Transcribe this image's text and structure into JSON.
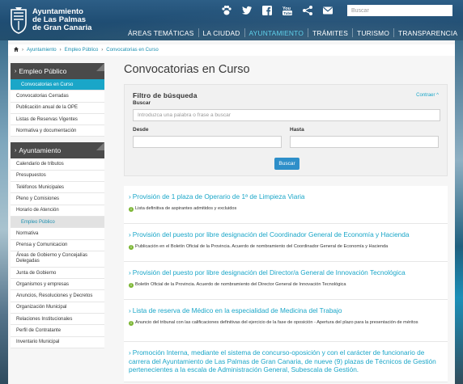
{
  "header": {
    "logo_line1": "Ayuntamiento",
    "logo_line2": "de Las Palmas",
    "logo_line3": "de Gran Canaria",
    "search_placeholder": "Buscar",
    "social_icons": [
      "paw-icon",
      "twitter-icon",
      "facebook-icon",
      "youtube-icon",
      "share-icon",
      "mail-icon"
    ],
    "nav": [
      {
        "label": "ÁREAS TEMÁTICAS",
        "active": false
      },
      {
        "label": "LA CIUDAD",
        "active": false
      },
      {
        "label": "AYUNTAMIENTO",
        "active": true
      },
      {
        "label": "TRÁMITES",
        "active": false
      },
      {
        "label": "TURISMO",
        "active": false
      },
      {
        "label": "TRANSPARENCIA",
        "active": false
      }
    ]
  },
  "breadcrumb": [
    "Ayuntamiento",
    "Empleo Público",
    "Convocatorias en Curso"
  ],
  "sidebar": {
    "section1_title": "Empleo Público",
    "section1_items": [
      "Convocatorias en Curso",
      "Convocatorias Cerradas",
      "Publicación anual de la OPE",
      "Listas de Reservas Vigentes",
      "Normativa y documentación"
    ],
    "section2_title": "Ayuntamiento",
    "section2_items": [
      "Calendario de tributos",
      "Presupuestos",
      "Teléfonos Municipales",
      "Pleno y Comisiones",
      "Horario de Atención",
      "Empleo Público",
      "Normativa",
      "Prensa y Comunicacion",
      "Áreas de Gobierno y Concejalías Delegadas",
      "Junta de Gobierno",
      "Organismos y empresas",
      "Anuncios, Resoluciones y Decretos",
      "Organización Municipal",
      "Relaciones Institucionales",
      "Perfil de Contratante",
      "Inventario Municipal"
    ]
  },
  "main": {
    "title": "Convocatorias en Curso",
    "filter": {
      "title": "Filtro de búsqueda",
      "collapse_label": "Contraer",
      "buscar_label": "Buscar",
      "buscar_placeholder": "Introduzca una palabra o frase a buscar",
      "desde_label": "Desde",
      "hasta_label": "Hasta",
      "button_label": "Buscar"
    },
    "results": [
      {
        "title": "Provisión de 1 plaza de Operario de 1ª de Limpieza Viaria",
        "sub": "Lista definitiva de aspirantes admitidos y excluidos"
      },
      {
        "title": "Provisión del puesto por libre designación del Coordinador General de Economía y Hacienda",
        "sub": "Publicación en el Boletín Oficial de la Provincia. Acuerdo de nombramiento del Coordinador General de Economía y Hacienda"
      },
      {
        "title": "Provisión del puesto por libre designación del Director/a General de Innovación Tecnológica",
        "sub": "Boletín Oficial de la Provincia. Acuerdo de nombramiento del Director General de Innovación Tecnológica"
      },
      {
        "title": "Lista de reserva de Médico en la especialidad de Medicina del Trabajo",
        "sub": "Anuncio del tribunal con las calificaciones definitivas del ejercicio de la fase de oposición - Apertura del plazo para la presentación de méritos"
      },
      {
        "title": "Promoción Interna, mediante el sistema de concurso-oposición y con el carácter de funcionario de carrera del Ayuntamiento de Las Palmas de Gran Canaria, de nueve (9) plazas de Técnicos de Gestión pertenecientes a la escala de Administración General, Subescala de Gestión.",
        "sub": ""
      }
    ]
  }
}
